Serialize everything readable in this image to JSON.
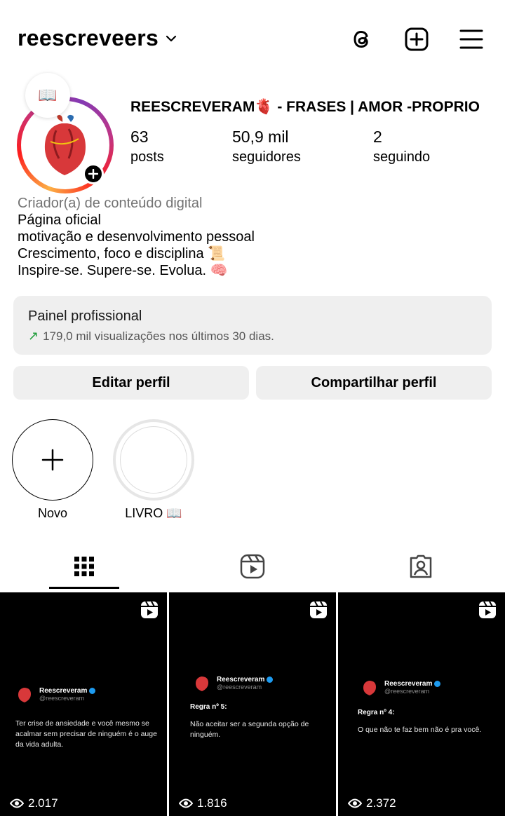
{
  "header": {
    "username": "reescreveers",
    "icons": [
      "threads-icon",
      "add-post-icon",
      "menu-icon"
    ]
  },
  "profile": {
    "note_emoji": "📖",
    "display_name": "REESCREVERAM🫀 - FRASES | AMOR -PROPRIO",
    "stats": [
      {
        "value": "63",
        "label": "posts"
      },
      {
        "value": "50,9 mil",
        "label": "seguidores"
      },
      {
        "value": "2",
        "label": "seguindo"
      }
    ]
  },
  "bio": {
    "category": "Criador(a) de conteúdo digital",
    "lines": [
      "Página oficial",
      "motivação e desenvolvimento pessoal",
      "Crescimento, foco e disciplina 📜",
      "Inspire-se. Supere-se. Evolua. 🧠"
    ]
  },
  "dashboard": {
    "title": "Painel profissional",
    "subtitle": "179,0 mil visualizações nos últimos 30 dias."
  },
  "buttons": {
    "edit": "Editar perfil",
    "share": "Compartilhar perfil"
  },
  "highlights": [
    {
      "label": "Novo"
    },
    {
      "label": "LIVRO 📖"
    }
  ],
  "grid": [
    {
      "name": "Reescreveram",
      "handle": "@reescreveram",
      "rule": "",
      "body": "Ter crise de ansiedade e você mesmo se acalmar sem precisar de ninguém é o auge da vida adulta.",
      "views": "2.017"
    },
    {
      "name": "Reescreveram",
      "handle": "@reescreveram",
      "rule": "Regra nº 5:",
      "body": "Não aceitar ser a segunda opção de ninguém.",
      "views": "1.816"
    },
    {
      "name": "Reescreveram",
      "handle": "@reescreveram",
      "rule": "Regra nº 4:",
      "body": "O que não te faz bem não é pra você.",
      "views": "2.372"
    }
  ],
  "colors": {
    "accent_gradient_start": "#fcb045",
    "accent_gradient_mid": "#fd1d1d",
    "accent_gradient_end": "#833ab4",
    "trend_green": "#1f9d3a",
    "verified_blue": "#1d9bf0",
    "button_bg": "#efefef"
  }
}
